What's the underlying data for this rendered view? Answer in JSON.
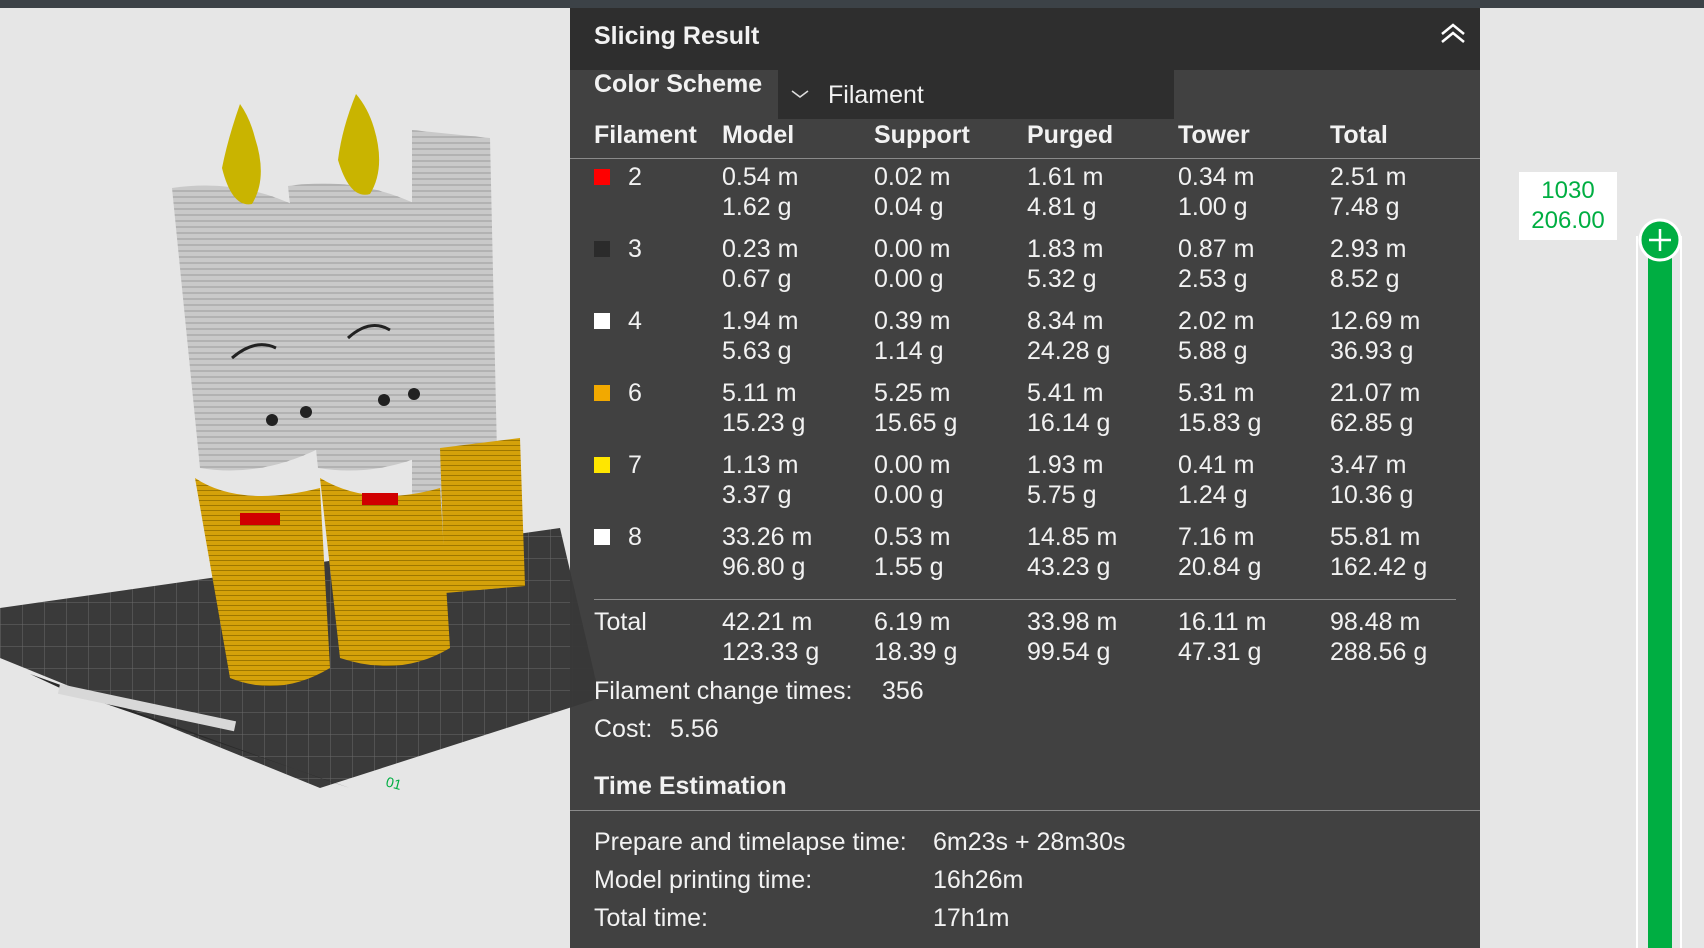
{
  "panel": {
    "title": "Slicing Result",
    "color_scheme_label": "Color Scheme",
    "color_scheme_value": "Filament"
  },
  "table": {
    "headers": [
      "Filament",
      "Model",
      "Support",
      "Purged",
      "Tower",
      "Total"
    ],
    "rows": [
      {
        "id": "2",
        "color": "#ff0000",
        "model_m": "0.54 m",
        "model_g": "1.62 g",
        "support_m": "0.02 m",
        "support_g": "0.04 g",
        "purged_m": "1.61 m",
        "purged_g": "4.81 g",
        "tower_m": "0.34 m",
        "tower_g": "1.00 g",
        "total_m": "2.51 m",
        "total_g": "7.48 g"
      },
      {
        "id": "3",
        "color": "#2b2b2b",
        "model_m": "0.23 m",
        "model_g": "0.67 g",
        "support_m": "0.00 m",
        "support_g": "0.00 g",
        "purged_m": "1.83 m",
        "purged_g": "5.32 g",
        "tower_m": "0.87 m",
        "tower_g": "2.53 g",
        "total_m": "2.93 m",
        "total_g": "8.52 g"
      },
      {
        "id": "4",
        "color": "#ffffff",
        "model_m": "1.94 m",
        "model_g": "5.63 g",
        "support_m": "0.39 m",
        "support_g": "1.14 g",
        "purged_m": "8.34 m",
        "purged_g": "24.28 g",
        "tower_m": "2.02 m",
        "tower_g": "5.88 g",
        "total_m": "12.69 m",
        "total_g": "36.93 g"
      },
      {
        "id": "6",
        "color": "#f2a900",
        "model_m": "5.11 m",
        "model_g": "15.23 g",
        "support_m": "5.25 m",
        "support_g": "15.65 g",
        "purged_m": "5.41 m",
        "purged_g": "16.14 g",
        "tower_m": "5.31 m",
        "tower_g": "15.83 g",
        "total_m": "21.07 m",
        "total_g": "62.85 g"
      },
      {
        "id": "7",
        "color": "#ffe600",
        "model_m": "1.13 m",
        "model_g": "3.37 g",
        "support_m": "0.00 m",
        "support_g": "0.00 g",
        "purged_m": "1.93 m",
        "purged_g": "5.75 g",
        "tower_m": "0.41 m",
        "tower_g": "1.24 g",
        "total_m": "3.47 m",
        "total_g": "10.36 g"
      },
      {
        "id": "8",
        "color": "#ffffff",
        "model_m": "33.26 m",
        "model_g": "96.80 g",
        "support_m": "0.53 m",
        "support_g": "1.55 g",
        "purged_m": "14.85 m",
        "purged_g": "43.23 g",
        "tower_m": "7.16 m",
        "tower_g": "20.84 g",
        "total_m": "55.81 m",
        "total_g": "162.42 g"
      }
    ],
    "total": {
      "label": "Total",
      "model_m": "42.21 m",
      "model_g": "123.33 g",
      "support_m": "6.19 m",
      "support_g": "18.39 g",
      "purged_m": "33.98 m",
      "purged_g": "99.54 g",
      "tower_m": "16.11 m",
      "tower_g": "47.31 g",
      "total_m": "98.48 m",
      "total_g": "288.56 g"
    }
  },
  "summary": {
    "filament_change_label": "Filament change times:",
    "filament_change_value": "356",
    "cost_label": "Cost:",
    "cost_value": "5.56"
  },
  "time": {
    "title": "Time Estimation",
    "prepare_label": "Prepare and timelapse time:",
    "prepare_value": "6m23s + 28m30s",
    "model_label": "Model printing time:",
    "model_value": "16h26m",
    "total_label": "Total time:",
    "total_value": "17h1m"
  },
  "layer_slider": {
    "layer": "1030",
    "height": "206.00",
    "accent": "#00ae42"
  }
}
